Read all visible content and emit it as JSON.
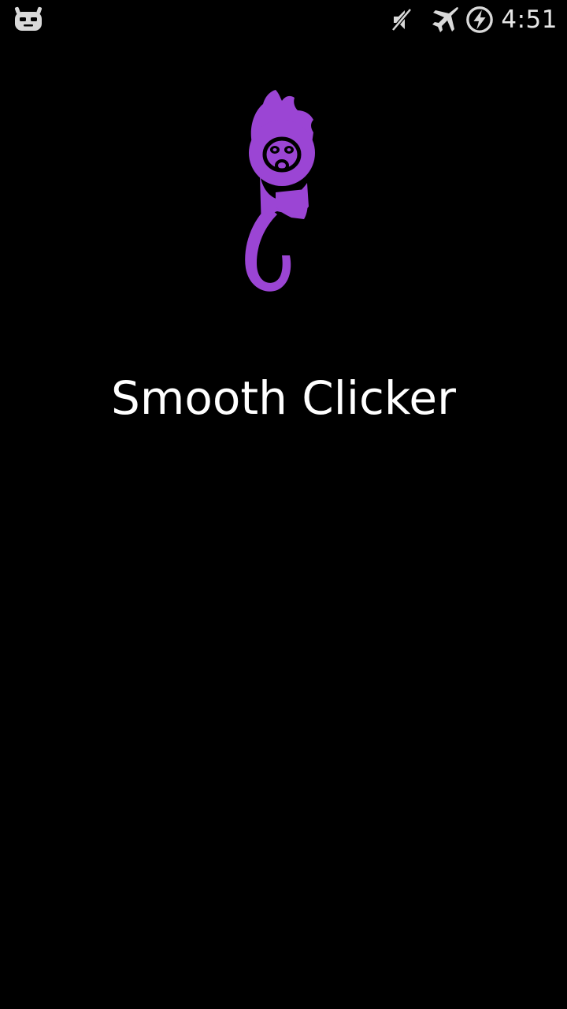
{
  "status_bar": {
    "time": "4:51",
    "icons": [
      "cyanogenmod-mascot-icon",
      "mute-icon",
      "airplane-mode-icon",
      "charging-icon"
    ],
    "icon_color": "#d9d9d9"
  },
  "splash": {
    "logo_icon": "purple-monkey-logo-icon",
    "logo_color": "#9b45d4",
    "title": "Smooth Clicker"
  },
  "colors": {
    "background": "#000000",
    "text": "#ffffff"
  }
}
